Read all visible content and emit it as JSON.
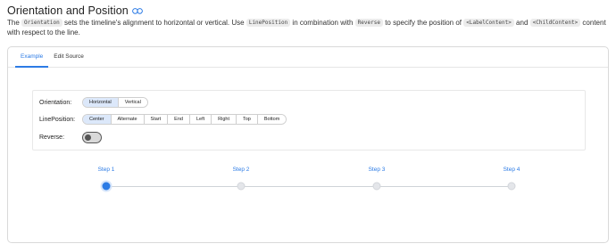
{
  "header": {
    "title": "Orientation and Position",
    "link_icon": "link-icon"
  },
  "description": {
    "t1": "The ",
    "c1": "Orientation",
    "t2": " sets the timeline's alignment to horizontal or vertical. Use ",
    "c2": "LinePosition",
    "t3": " in combination with ",
    "c3": "Reverse",
    "t4": " to specify the position of ",
    "c4": "<LabelContent>",
    "t5": " and ",
    "c5": "<ChildContent>",
    "t6": " content with respect to the line."
  },
  "tabs": [
    {
      "label": "Example",
      "active": true
    },
    {
      "label": "Edit Source",
      "active": false
    }
  ],
  "options": {
    "orientation": {
      "label": "Orientation:",
      "items": [
        "Horizontal",
        "Vertical"
      ],
      "selected": "Horizontal"
    },
    "line_position": {
      "label": "LinePosition:",
      "items": [
        "Center",
        "Alternate",
        "Start",
        "End",
        "Left",
        "Right",
        "Top",
        "Bottom"
      ],
      "selected": "Center"
    },
    "reverse": {
      "label": "Reverse:",
      "on": false
    }
  },
  "timeline": {
    "steps": [
      {
        "label": "Step 1",
        "active": true
      },
      {
        "label": "Step 2",
        "active": false
      },
      {
        "label": "Step 3",
        "active": false
      },
      {
        "label": "Step 4",
        "active": false
      }
    ]
  },
  "colors": {
    "accent": "#2c7be5",
    "selected_bg": "#dce8fa"
  }
}
